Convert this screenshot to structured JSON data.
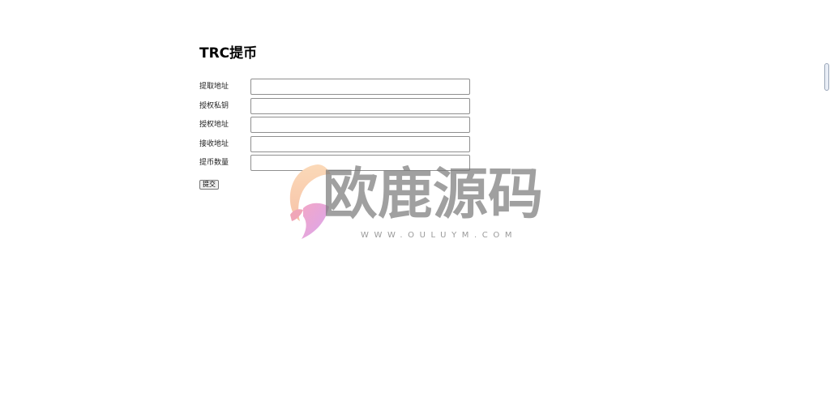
{
  "form": {
    "title": "TRC提币",
    "fields": [
      {
        "label": "提取地址",
        "value": "",
        "placeholder": ""
      },
      {
        "label": "授权私钥",
        "value": "",
        "placeholder": ""
      },
      {
        "label": "授权地址",
        "value": "",
        "placeholder": ""
      },
      {
        "label": "接收地址",
        "value": "",
        "placeholder": ""
      },
      {
        "label": "提币数量",
        "value": "",
        "placeholder": ""
      }
    ],
    "submit_label": "提交"
  },
  "watermark": {
    "text": "欧鹿源码",
    "url": "WWW.OULUYM.COM"
  }
}
